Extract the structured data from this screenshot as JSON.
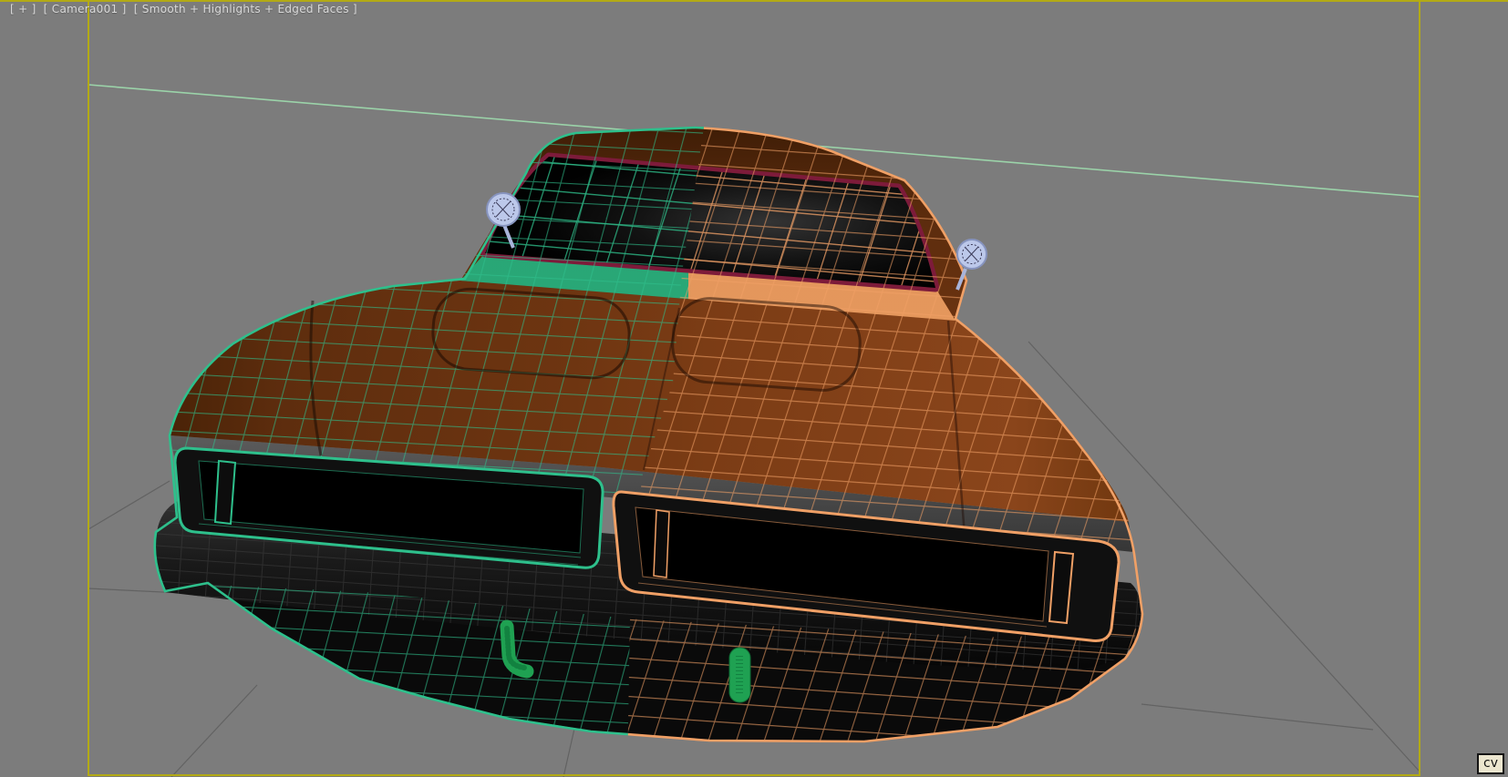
{
  "viewport": {
    "nav_label": "[ + ]",
    "camera_label": "[ Camera001 ]",
    "shading_label": "[ Smooth + Highlights + Edged Faces ]"
  },
  "badge": {
    "text": "cv"
  },
  "colors": {
    "background": "#7c7c7c",
    "viewport_border": "#b3aa15",
    "horizon_line": "#9bd3a9",
    "ground_line": "#5e5e5e",
    "wire_left": "#2ec08c",
    "wire_right": "#f0a066",
    "windshield_trim": "#7d1b3a",
    "body_brown_left": "#63300f",
    "body_brown_right": "#8a451b",
    "glass_black": "#050505",
    "bumper_black": "#151515",
    "grille_gray_strip": "#4d4d4d",
    "mirror": "#bcc8ea",
    "guard_green": "#1fa152",
    "label_text": "#d9d9d9",
    "badge_bg": "#ece6cf",
    "badge_text": "#111111"
  }
}
